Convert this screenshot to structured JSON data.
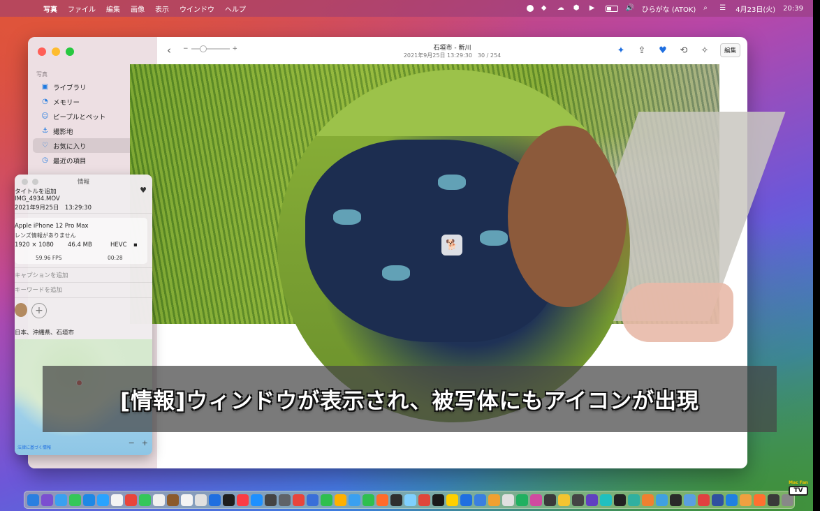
{
  "menubar": {
    "app": "写真",
    "items": [
      "ファイル",
      "編集",
      "画像",
      "表示",
      "ウインドウ",
      "ヘルプ"
    ],
    "input_method": "ひらがな (ATOK)",
    "date": "4月23日(火)",
    "time": "20:39"
  },
  "sidebar": {
    "section": "写真",
    "items": [
      {
        "label": "ライブラリ",
        "icon": "photo-library-icon"
      },
      {
        "label": "メモリー",
        "icon": "memories-icon"
      },
      {
        "label": "ピープルとペット",
        "icon": "people-icon"
      },
      {
        "label": "撮影地",
        "icon": "map-pin-icon"
      },
      {
        "label": "お気に入り",
        "icon": "heart-icon",
        "active": true
      },
      {
        "label": "最近の項目",
        "icon": "clock-icon"
      }
    ]
  },
  "toolbar": {
    "title": "石垣市 - 新川",
    "subtitle": "2021年9月25日 13:29:30　30 / 254",
    "zoom_minus": "−",
    "zoom_plus": "+",
    "edit_label": "編集"
  },
  "info_panel": {
    "title": "情報",
    "add_title": "タイトルを追加",
    "filename": "IMG_4934.MOV",
    "datetime": "2021年9月25日　13:29:30",
    "device": "Apple iPhone 12 Pro Max",
    "lens": "レンズ情報がありません",
    "resolution": "1920 × 1080",
    "size": "46.4 MB",
    "codec": "HEVC",
    "fps": "59.96 FPS",
    "duration": "00:28",
    "caption_placeholder": "キャプションを追加",
    "keyword_placeholder": "キーワードを追加",
    "location": "日本、沖縄県、石垣市",
    "map_credit": "法律に基づく情報",
    "map_zoom_minus": "−",
    "map_zoom_plus": "+"
  },
  "caption": {
    "text": "[情報]ウィンドウが表示され、被写体にもアイコンが出現"
  },
  "dock_colors": [
    "#2a7fe0",
    "#7b4fd0",
    "#3aa0f0",
    "#34c759",
    "#1e88e5",
    "#29a3ff",
    "#f4f4f4",
    "#e8453c",
    "#34c759",
    "#f0f0f0",
    "#8b5a2b",
    "#f4f4f4",
    "#e0e0e0",
    "#1f6fe0",
    "#1e1e1e",
    "#fc3c44",
    "#1e90ff",
    "#444",
    "#5f6368",
    "#e8453c",
    "#3a6fd8",
    "#2fbf4f",
    "#ffb000",
    "#3aa0f0",
    "#2fbf4f",
    "#ff6b2b",
    "#2f2f2f",
    "#7fd0ff",
    "#e0463a",
    "#1a1a1a",
    "#ffd000",
    "#1f6fe0",
    "#3a7fe0",
    "#f0a030",
    "#e0e0e0",
    "#20b060",
    "#d04aa0",
    "#3a3a3a",
    "#f4c430",
    "#444",
    "#6040c0",
    "#20c0c0",
    "#222",
    "#30b0a0",
    "#f08030",
    "#40a0e0",
    "#2a2a2a",
    "#5a9fe0",
    "#e04040",
    "#3050a0",
    "#2080e0",
    "#f0a040",
    "#ff7030",
    "#3a3a3a",
    "#888",
    "#40b0e0",
    "#f0f0f0"
  ],
  "channel_logo": {
    "top": "Mac Fan",
    "tv": "TV"
  }
}
